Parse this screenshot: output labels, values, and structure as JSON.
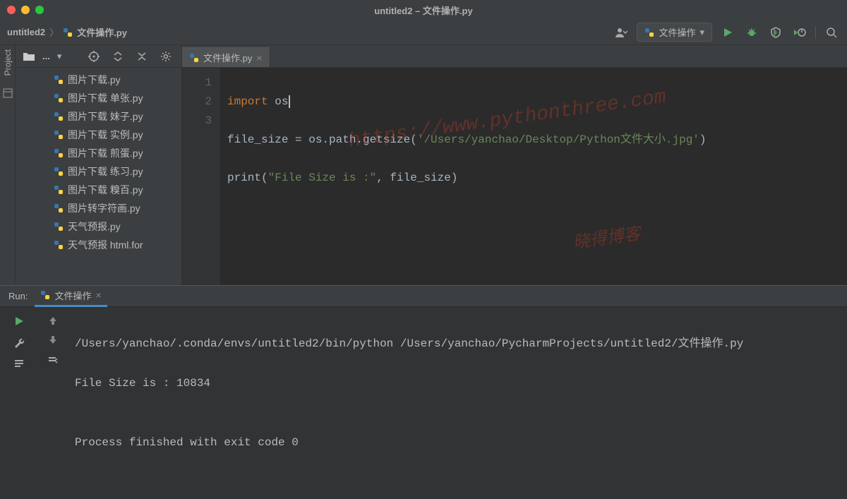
{
  "titlebar": {
    "title": "untitled2 – 文件操作.py"
  },
  "breadcrumb": {
    "project": "untitled2",
    "file": "文件操作.py"
  },
  "run_config": {
    "label": "文件操作"
  },
  "project_panel": {
    "tab_label": "Project",
    "toolbar_dots": "...",
    "files": [
      "图片下载.py",
      "图片下载 单张.py",
      "图片下载 妹子.py",
      "图片下载 实例.py",
      "图片下载 煎蛋.py",
      "图片下载 练习.py",
      "图片下载 糗百.py",
      "图片转字符画.py",
      "天气预报.py",
      "天气预报 html.for"
    ]
  },
  "editor": {
    "tab_name": "文件操作.py",
    "gutter": [
      "1",
      "2",
      "3"
    ],
    "line1_kw": "import",
    "line1_mod": " os",
    "line2_a": "file_size = os.path.getsize(",
    "line2_str": "'/Users/yanchao/Desktop/Python文件大小.jpg'",
    "line2_b": ")",
    "line3_a": "print(",
    "line3_str": "\"File Size is :\"",
    "line3_b": ", file_size)"
  },
  "watermark": {
    "w1": "https://www.pythonthree.com",
    "w2": "晓得博客"
  },
  "run": {
    "label": "Run:",
    "tab": "文件操作",
    "line1": "/Users/yanchao/.conda/envs/untitled2/bin/python /Users/yanchao/PycharmProjects/untitled2/文件操作.py",
    "line2": "File Size is : 10834",
    "line3": "",
    "line4": "Process finished with exit code 0"
  }
}
